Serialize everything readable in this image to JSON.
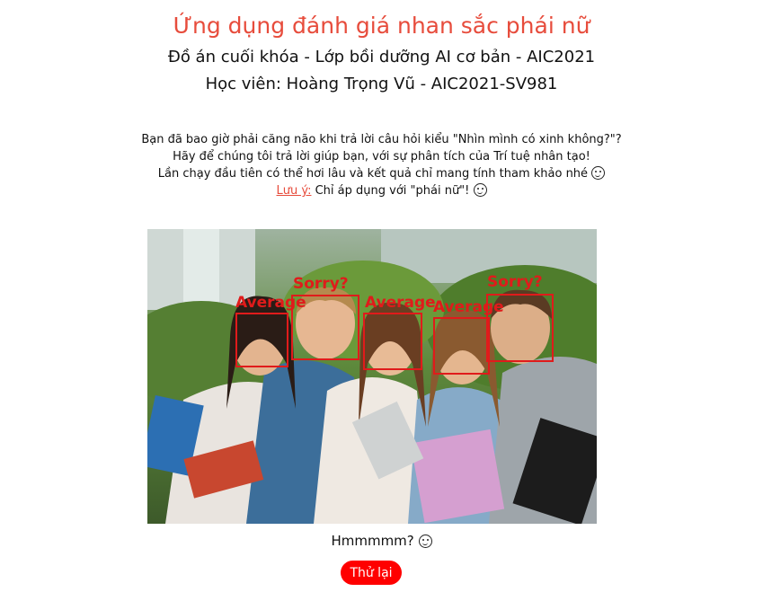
{
  "header": {
    "title": "Ứng dụng đánh giá nhan sắc phái nữ",
    "subtitle": "Đồ án cuối khóa - Lớp bồi dưỡng AI cơ bản - AIC2021",
    "student": "Học viên: Hoàng Trọng Vũ - AIC2021-SV981"
  },
  "intro": {
    "line1": "Bạn đã bao giờ phải căng não khi trả lời câu hỏi kiểu \"Nhìn mình có xinh không?\"?",
    "line2": "Hãy để chúng tôi trả lời giúp bạn, với sự phân tích của Trí tuệ nhân tạo!",
    "line3": "Lần chạy đầu tiên có thể hơi lâu và kết quả chỉ mang tính tham khảo nhé",
    "note_label": "Lưu ý:",
    "note_text": " Chỉ áp dụng với \"phái nữ\"!"
  },
  "detections": [
    {
      "label": "Average"
    },
    {
      "label": "Sorry?"
    },
    {
      "label": "Average"
    },
    {
      "label": "Average"
    },
    {
      "label": "Sorry?"
    }
  ],
  "result": {
    "text": "Hmmmmm?"
  },
  "actions": {
    "retry_label": "Thử lại"
  },
  "colors": {
    "accent": "#e74c3c",
    "button": "#ff0000",
    "detection": "#e01b1b"
  },
  "icons": {
    "wink": "winking-face-icon",
    "drool": "drooling-face-icon",
    "dizzy": "dizzy-face-icon"
  }
}
